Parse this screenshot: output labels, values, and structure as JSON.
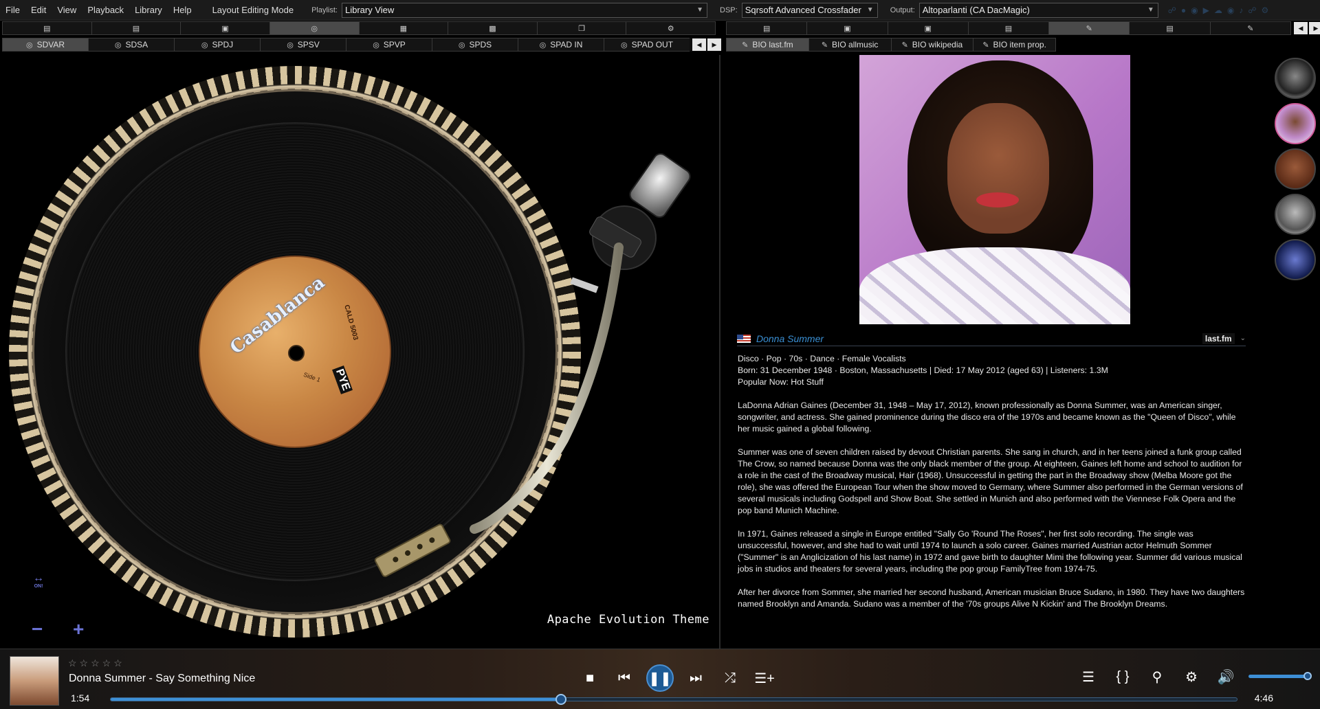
{
  "menu": [
    "File",
    "Edit",
    "View",
    "Playback",
    "Library",
    "Help"
  ],
  "layout_mode": "Layout Editing Mode",
  "playlist": {
    "label": "Playlist:",
    "value": "Library View"
  },
  "dsp": {
    "label": "DSP:",
    "value": "Sqrsoft Advanced Crossfader"
  },
  "output": {
    "label": "Output:",
    "value": "Altoparlanti (CA DacMagic)"
  },
  "left_icon_tabs": [
    "document-icon",
    "book-icon",
    "cassette-icon",
    "record-icon",
    "columns-icon",
    "chart-icon",
    "copy-icon",
    "gear-icon"
  ],
  "left_tabs": [
    "SDVAR",
    "SDSA",
    "SPDJ",
    "SPSV",
    "SPVP",
    "SPDS",
    "SPAD IN",
    "SPAD OUT"
  ],
  "right_icon_tabs": [
    "document-icon",
    "image-icon",
    "cassette-icon",
    "list-icon",
    "biography-icon",
    "panel-icon",
    "edit-icon"
  ],
  "right_tabs": [
    "BIO last.fm",
    "BIO allmusic",
    "BIO wikipedia",
    "BIO item prop."
  ],
  "turntable": {
    "label_title": "Casablanca",
    "label_side": "Side 1",
    "label_catalog": "CALD 5003",
    "label_brand": "PYE",
    "theme": "Apache Evolution Theme",
    "on_label": "ON!"
  },
  "bio": {
    "artist": "Donna Summer",
    "source": "last.fm",
    "tags": "Disco · Pop · 70s · Dance · Female Vocalists",
    "born": "Born: 31 December 1948 · Boston, Massachusetts  |  Died: 17 May 2012 (aged 63)  |  Listeners: 1.3M",
    "popular": "Popular Now: Hot Stuff",
    "paragraphs": [
      "LaDonna Adrian Gaines (December 31, 1948 – May 17, 2012), known professionally as Donna Summer, was an American singer, songwriter, and actress. She gained prominence during the disco era of the 1970s and became known as the \"Queen of Disco\", while her music gained a global following.",
      "Summer was one of seven children raised by devout Christian parents. She sang in church, and in her teens joined a funk group called The Crow, so named because Donna was the only black member of the group. At eighteen, Gaines left home and school to audition for a role in the cast of the Broadway musical, Hair (1968). Unsuccessful in getting the part in the Broadway show (Melba Moore got the role), she was offered the European Tour when the show moved to Germany, where Summer also performed in the German versions of several musicals including Godspell and Show Boat. She settled in Munich and also performed with the Viennese Folk Opera and the pop band Munich Machine.",
      "In 1971, Gaines released a single in Europe entitled \"Sally Go 'Round The Roses\", her first solo recording. The single was unsuccessful, however, and she had to wait until 1974 to launch a solo career. Gaines married Austrian actor Helmuth Sommer (\"Summer\" is an Anglicization of his last name) in 1972 and gave birth to daughter Mimi the following year. Summer did various musical jobs in studios and theaters for several years, including the pop group FamilyTree from 1974-75.",
      "After her divorce from Sommer, she married her second husband, American musician Bruce Sudano, in 1980. They have two daughters named Brooklyn and Amanda. Sudano was a member of the '70s groups Alive N Kickin' and The Brooklyn Dreams."
    ]
  },
  "player": {
    "rating": "☆☆☆☆☆",
    "track": "Donna Summer - Say Something Nice",
    "elapsed": "1:54",
    "total": "4:46",
    "progress": 0.4,
    "volume": 1.0,
    "accent": "#3d8fd6"
  }
}
